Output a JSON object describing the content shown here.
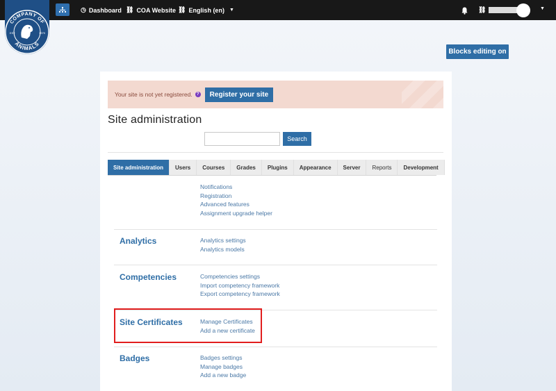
{
  "navbar": {
    "dashboard": "Dashboard",
    "coa_website": "COA Website",
    "language": "English (en)"
  },
  "logo": {
    "top_text": "COMPANY OF",
    "bottom_text": "ANIMALS",
    "est": "EST.",
    "year": "1979"
  },
  "blocks_editing": "Blocks editing on",
  "alert": {
    "text": "Your site is not yet registered.",
    "help": "?",
    "register": "Register your site"
  },
  "page_title": "Site administration",
  "search": {
    "button": "Search",
    "value": ""
  },
  "tabs": [
    "Site administration",
    "Users",
    "Courses",
    "Grades",
    "Plugins",
    "Appearance",
    "Server",
    "Reports",
    "Development"
  ],
  "sections": {
    "general": {
      "links": [
        "Notifications",
        "Registration",
        "Advanced features",
        "Assignment upgrade helper"
      ]
    },
    "analytics": {
      "title": "Analytics",
      "links": [
        "Analytics settings",
        "Analytics models"
      ]
    },
    "competencies": {
      "title": "Competencies",
      "links": [
        "Competencies settings",
        "Import competency framework",
        "Export competency framework"
      ]
    },
    "site_certificates": {
      "title": "Site Certificates",
      "links": [
        "Manage Certificates",
        "Add a new certificate"
      ]
    },
    "badges": {
      "title": "Badges",
      "links": [
        "Badges settings",
        "Manage badges",
        "Add a new badge"
      ]
    }
  },
  "colors": {
    "accent": "#2f6ea6",
    "navbar": "#181818",
    "alert_bg": "#f3d9d0",
    "highlight": "#e11d1d"
  }
}
